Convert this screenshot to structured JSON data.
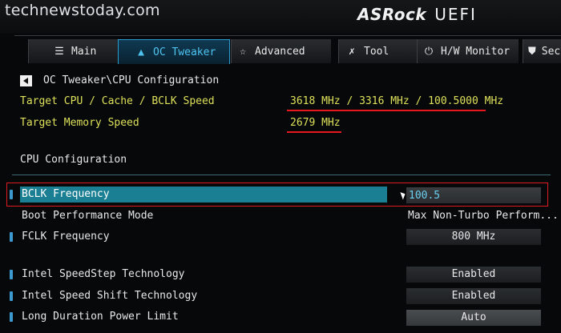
{
  "watermark": "technewstoday.com",
  "brand": {
    "name": "ASRock",
    "product": "UEFI"
  },
  "tabs": [
    {
      "label": "Main",
      "icon": "list-icon",
      "active": false
    },
    {
      "label": "OC Tweaker",
      "icon": "rocket-icon",
      "active": true
    },
    {
      "label": "Advanced",
      "icon": "star-icon",
      "active": false
    },
    {
      "label": "Tool",
      "icon": "tools-icon",
      "active": false
    },
    {
      "label": "H/W Monitor",
      "icon": "power-icon",
      "active": false
    },
    {
      "label": "Secu",
      "icon": "shield-icon",
      "active": false
    }
  ],
  "breadcrumb": "OC Tweaker\\CPU Configuration",
  "info": {
    "target_cpu_label": "Target CPU / Cache / BCLK Speed",
    "target_cpu_value": "3618 MHz / 3316 MHz / 100.5000 MHz",
    "target_mem_label": "Target Memory Speed",
    "target_mem_value": "2679 MHz"
  },
  "section_title": "CPU Configuration",
  "settings": [
    {
      "label": "BCLK Frequency",
      "value": "100.5"
    },
    {
      "label": "Boot Performance Mode",
      "value": "Max Non-Turbo Perform..."
    },
    {
      "label": "FCLK Frequency",
      "value": "800 MHz"
    },
    {
      "label": "Intel SpeedStep Technology",
      "value": "Enabled"
    },
    {
      "label": "Intel Speed Shift Technology",
      "value": "Enabled"
    },
    {
      "label": "Long Duration Power Limit",
      "value": "Auto"
    }
  ],
  "colors": {
    "accent": "#2c9cd0",
    "highlight": "#1b7f94",
    "info_text": "#dde05a",
    "annotation_red": "#e01a22"
  }
}
